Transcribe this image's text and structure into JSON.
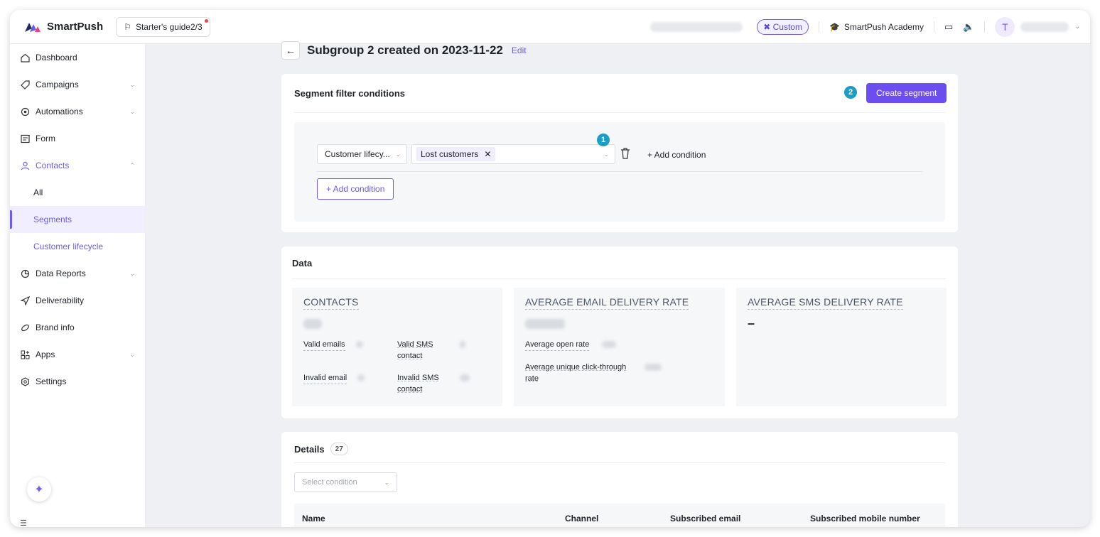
{
  "topbar": {
    "app_name": "SmartPush",
    "guide_label": "Starter's guide2/3",
    "custom_label": "✖ Custom",
    "academy_label": "SmartPush Academy",
    "avatar_initial": "T"
  },
  "sidebar": {
    "items": [
      {
        "label": "Dashboard",
        "icon": "home-icon"
      },
      {
        "label": "Campaigns",
        "icon": "tag-icon"
      },
      {
        "label": "Automations",
        "icon": "automation-icon"
      },
      {
        "label": "Form",
        "icon": "form-icon"
      },
      {
        "label": "Contacts",
        "icon": "user-icon"
      },
      {
        "label": "All"
      },
      {
        "label": "Segments"
      },
      {
        "label": "Customer lifecycle"
      },
      {
        "label": "Data Reports",
        "icon": "pie-chart-icon"
      },
      {
        "label": "Deliverability",
        "icon": "send-icon"
      },
      {
        "label": "Brand info",
        "icon": "brand-icon"
      },
      {
        "label": "Apps",
        "icon": "apps-icon"
      },
      {
        "label": "Settings",
        "icon": "settings-icon"
      }
    ]
  },
  "page": {
    "title": "Subgroup 2 created on 2023-11-22",
    "edit_label": "Edit"
  },
  "filter": {
    "title": "Segment filter conditions",
    "create_button": "Create segment",
    "badge_create": "2",
    "badge_condition": "1",
    "field_select": "Customer lifecy...",
    "value_tag": "Lost customers",
    "inline_add": "+ Add condition",
    "add_button": "+ Add condition"
  },
  "data": {
    "title": "Data",
    "contacts": {
      "heading": "CONTACTS",
      "valid_emails": "Valid emails",
      "valid_sms": "Valid SMS contact",
      "invalid_email": "Invalid email",
      "invalid_sms": "Invalid SMS contact"
    },
    "email_rate": {
      "heading": "AVERAGE EMAIL DELIVERY RATE",
      "open_rate": "Average open rate",
      "click_rate": "Average unique click-through rate"
    },
    "sms_rate": {
      "heading": "AVERAGE SMS DELIVERY RATE",
      "value": "–"
    }
  },
  "details": {
    "title": "Details",
    "count": "27",
    "select_placeholder": "Select condition",
    "columns": [
      "Name",
      "Channel",
      "Subscribed email",
      "Subscribed mobile number"
    ]
  }
}
